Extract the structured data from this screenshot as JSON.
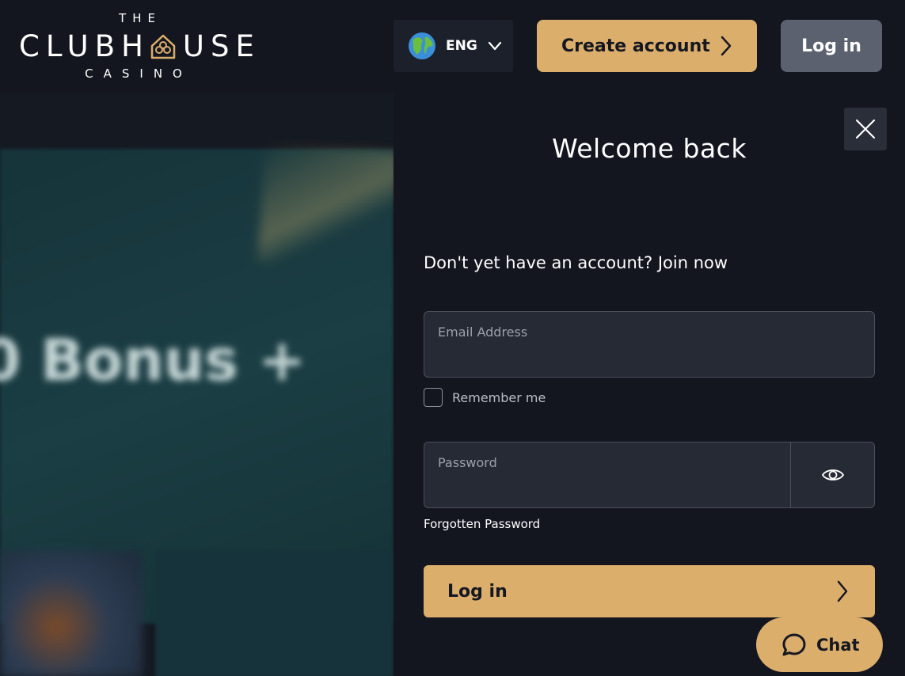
{
  "header": {
    "logo": {
      "top": "THE",
      "main_left": "CLUBH",
      "main_right": "USE",
      "bottom": "CASINO"
    },
    "language": {
      "code": "ENG"
    },
    "create_account_label": "Create account",
    "login_label": "Log in"
  },
  "background": {
    "banner_text": "0 Bonus +"
  },
  "login_panel": {
    "title": "Welcome back",
    "join_prompt": "Don't yet have an account?",
    "join_link": "Join now",
    "email_label": "Email Address",
    "email_value": "",
    "remember_label": "Remember me",
    "remember_checked": false,
    "password_label": "Password",
    "password_value": "",
    "forgot_label": "Forgotten Password",
    "submit_label": "Log in"
  },
  "chat": {
    "label": "Chat"
  },
  "colors": {
    "accent": "#dcae6c",
    "background": "#13161f",
    "field_bg": "#262a35",
    "secondary_button": "#5c6170"
  }
}
